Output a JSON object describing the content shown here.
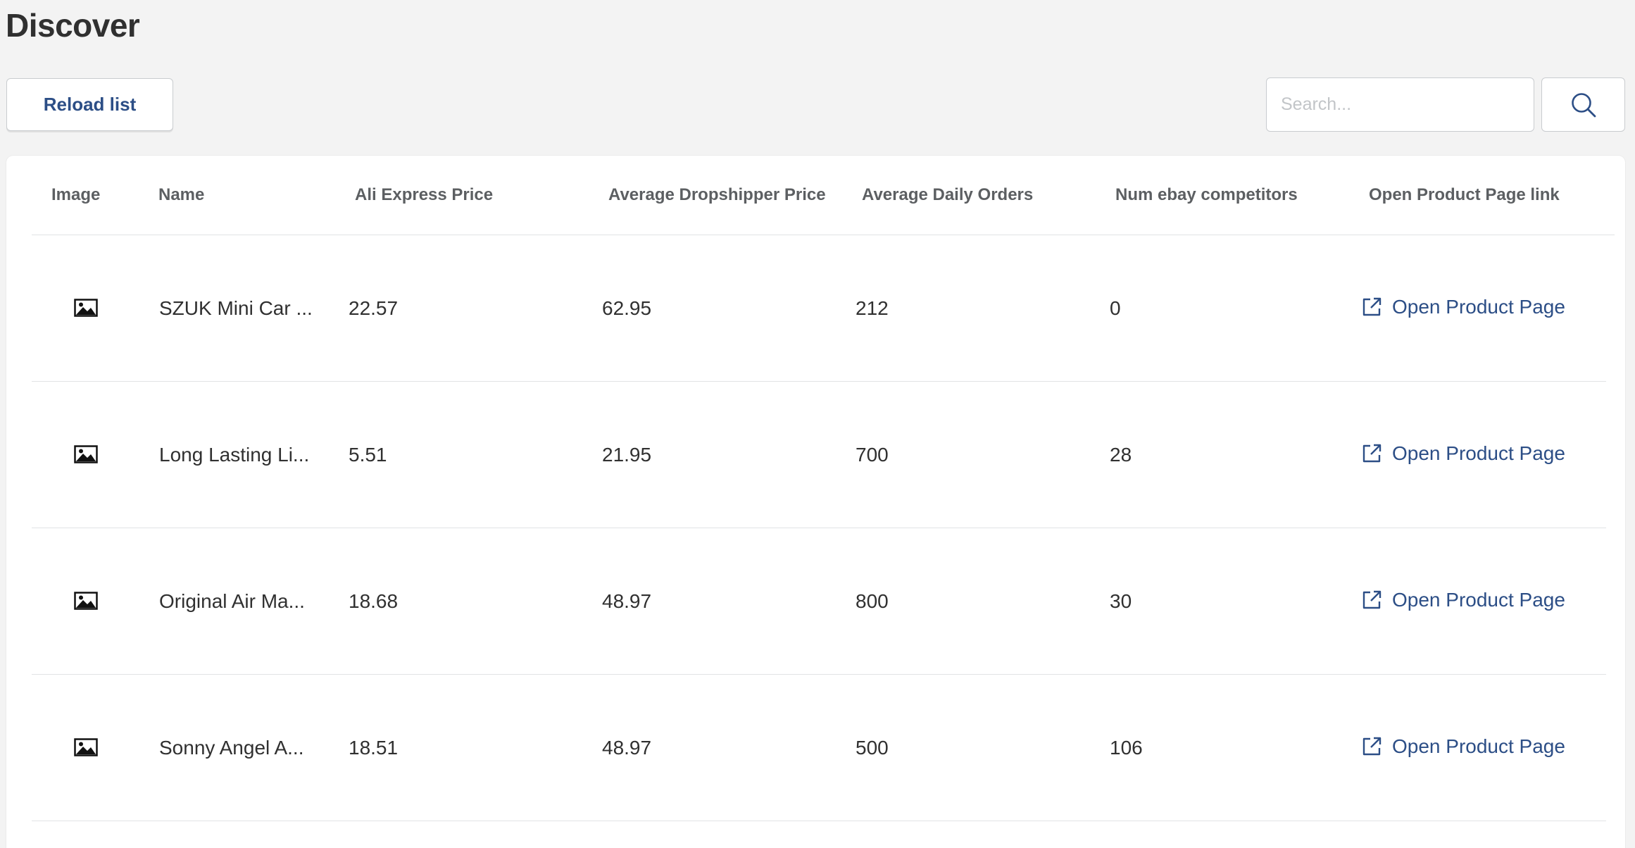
{
  "page": {
    "title": "Discover"
  },
  "toolbar": {
    "reload_label": "Reload list",
    "search_placeholder": "Search...",
    "search_value": "",
    "search_icon": "search-icon"
  },
  "table": {
    "columns": [
      "Image",
      "Name",
      "Ali Express Price",
      "Average Dropshipper Price",
      "Average Daily Orders",
      "Num ebay competitors",
      "Open Product Page link"
    ],
    "rows": [
      {
        "image_icon": "image-placeholder-icon",
        "name": "SZUK Mini Car ...",
        "ali_express_price": "22.57",
        "avg_dropshipper_price": "62.95",
        "avg_daily_orders": "212",
        "num_ebay_competitors": "0",
        "link_label": "Open Product Page"
      },
      {
        "image_icon": "image-placeholder-icon",
        "name": "Long Lasting Li...",
        "ali_express_price": "5.51",
        "avg_dropshipper_price": "21.95",
        "avg_daily_orders": "700",
        "num_ebay_competitors": "28",
        "link_label": "Open Product Page"
      },
      {
        "image_icon": "image-placeholder-icon",
        "name": "Original Air Ma...",
        "ali_express_price": "18.68",
        "avg_dropshipper_price": "48.97",
        "avg_daily_orders": "800",
        "num_ebay_competitors": "30",
        "link_label": "Open Product Page"
      },
      {
        "image_icon": "image-placeholder-icon",
        "name": "Sonny Angel A...",
        "ali_express_price": "18.51",
        "avg_dropshipper_price": "48.97",
        "avg_daily_orders": "500",
        "num_ebay_competitors": "106",
        "link_label": "Open Product Page"
      }
    ]
  },
  "colors": {
    "background": "#f3f3f3",
    "card": "#ffffff",
    "link": "#2c4e86",
    "header_text": "#5c5f62",
    "body_text": "#303030",
    "divider": "#e1e3e5"
  }
}
